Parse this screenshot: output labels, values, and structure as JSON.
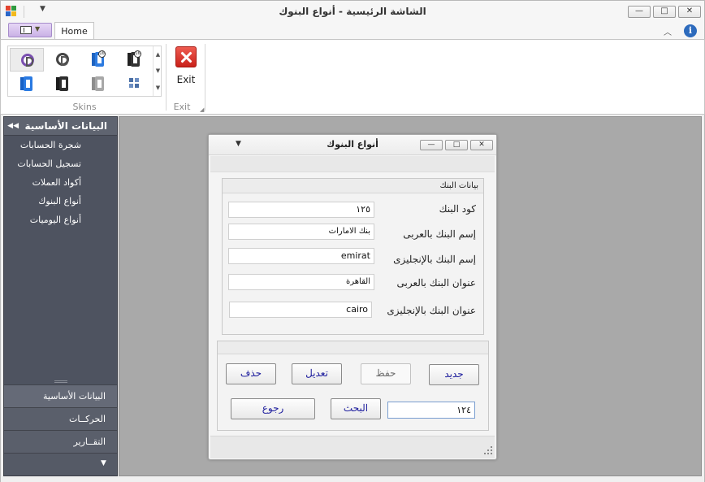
{
  "window": {
    "title": "الشاشة الرئيسية - أنواع البنوك",
    "qa_dropdown": "▼",
    "min_glyph": "—",
    "max_glyph": "□",
    "close_glyph": "✕"
  },
  "ribbon": {
    "tab_home": "Home",
    "group_skins_label": "Skins",
    "group_exit_label": "Exit",
    "exit_button_label": "Exit",
    "collapse_glyph": "︿",
    "info_glyph": "i",
    "scroll_up": "▲",
    "scroll_down": "▼",
    "scroll_more": "▼",
    "launcher_glyph": "◢",
    "skins": [
      {
        "icon": "office-2019-colorful-icon"
      },
      {
        "icon": "office-2019-black-icon"
      },
      {
        "icon": "office-2016-colorful-icon"
      },
      {
        "icon": "office-2016-black-icon"
      },
      {
        "icon": "office-blue-icon"
      },
      {
        "icon": "office-black-icon"
      },
      {
        "icon": "office-gray-icon"
      },
      {
        "icon": "metro-tiles-icon"
      }
    ]
  },
  "nav": {
    "header": "البيانات الأساسية",
    "collapse_glyph": "◀◀",
    "items": [
      {
        "label": "شجرة الحسابات"
      },
      {
        "label": "تسجيل الحسابات"
      },
      {
        "label": "أكواد العملات"
      },
      {
        "label": "أنواع البنوك"
      },
      {
        "label": "أنواع اليوميات"
      }
    ],
    "groups": [
      {
        "label": "البيانات الأساسية"
      },
      {
        "label": "الحركــات"
      },
      {
        "label": "التقــارير"
      }
    ],
    "overflow_glyph": "▼"
  },
  "child": {
    "title": "أنواع البنوك",
    "sysmenu_glyph": "▼",
    "groupbox_caption": "بيانات البنك",
    "fields": [
      {
        "label": "كود البنك",
        "value": "١٢٥"
      },
      {
        "label": "إسم البنك بالعربى",
        "value": "بنك الامارات"
      },
      {
        "label": "إسم البنك بالإنجليزى",
        "value": "emirat"
      },
      {
        "label": "عنوان البنك بالعربى",
        "value": "القاهرة"
      },
      {
        "label": "عنوان البنك بالإنجليزى",
        "value": "cairo"
      }
    ],
    "buttons": {
      "new": "جديد",
      "save": "حفظ",
      "edit": "تعديل",
      "delete": "حذف",
      "search": "البحث",
      "back": "رجوع"
    },
    "search_value": "١٢٤"
  },
  "colors": {
    "nav_bg": "#4e5360",
    "mdi_bg": "#a9a9a9",
    "button_text": "#1f1f9e",
    "exit_red": "#d63027"
  }
}
